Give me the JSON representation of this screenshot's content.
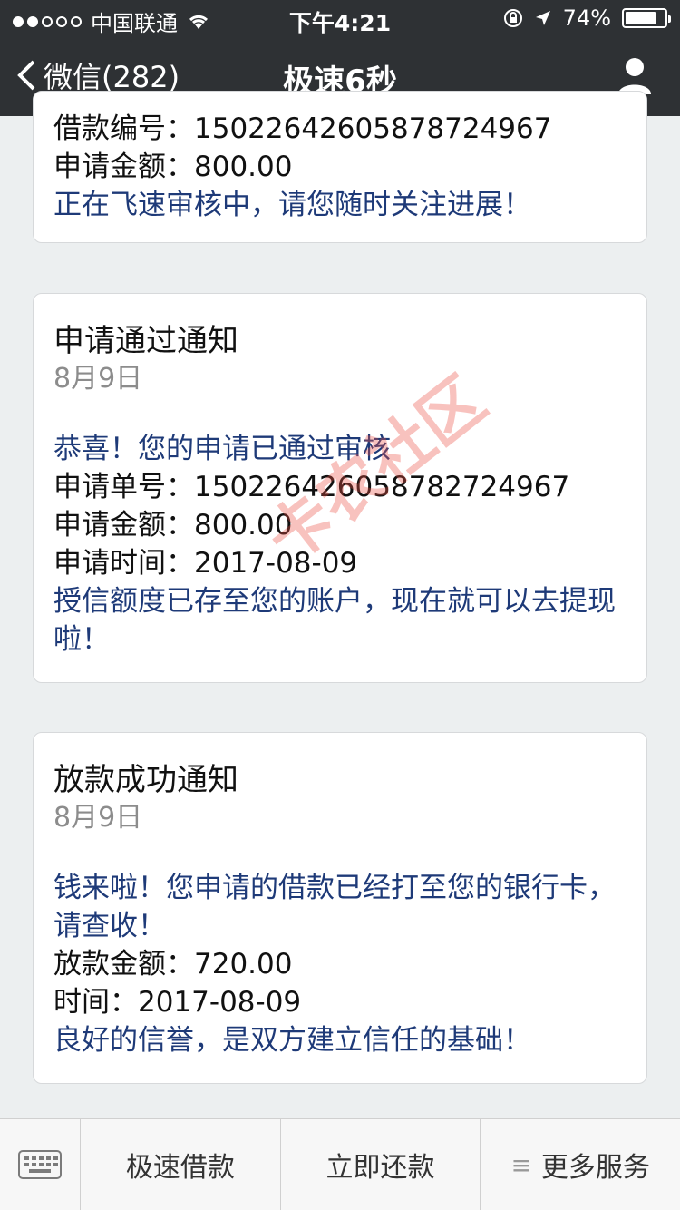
{
  "status": {
    "carrier": "中国联通",
    "time": "下午4:21",
    "battery": "74%",
    "battery_level": 0.74
  },
  "nav": {
    "back": "微信(282)",
    "title": "极速6秒"
  },
  "card1": {
    "loan_no_line": "借款编号：1502264260587872496​7",
    "amount_line": "申请金额：800.00",
    "status_line": "正在飞速审核中，请您随时关注进展！"
  },
  "card2": {
    "title": "申请通过通知",
    "date": "8月9日",
    "congrats": "恭喜！您的申请已通过审核",
    "order_line": "申请单号：15022642605878272496​7",
    "amount_line": "申请金额：800.00",
    "time_line": "申请时间：2017-08-09",
    "note": "授信额度已存至您的账户，现在就可以去提现啦！"
  },
  "card3": {
    "title": "放款成功通知",
    "date": "8月9日",
    "message": "钱来啦！您申请的借款已经打至您的银行卡，请查收！",
    "amount_line": "放款金额：720.00",
    "time_line": "时间：2017-08-09",
    "note": "良好的信誉，是双方建立信任的基础！"
  },
  "watermark": "卡农社区",
  "menu": {
    "item1": "极速借款",
    "item2": "立即还款",
    "item3": "更多服务"
  }
}
